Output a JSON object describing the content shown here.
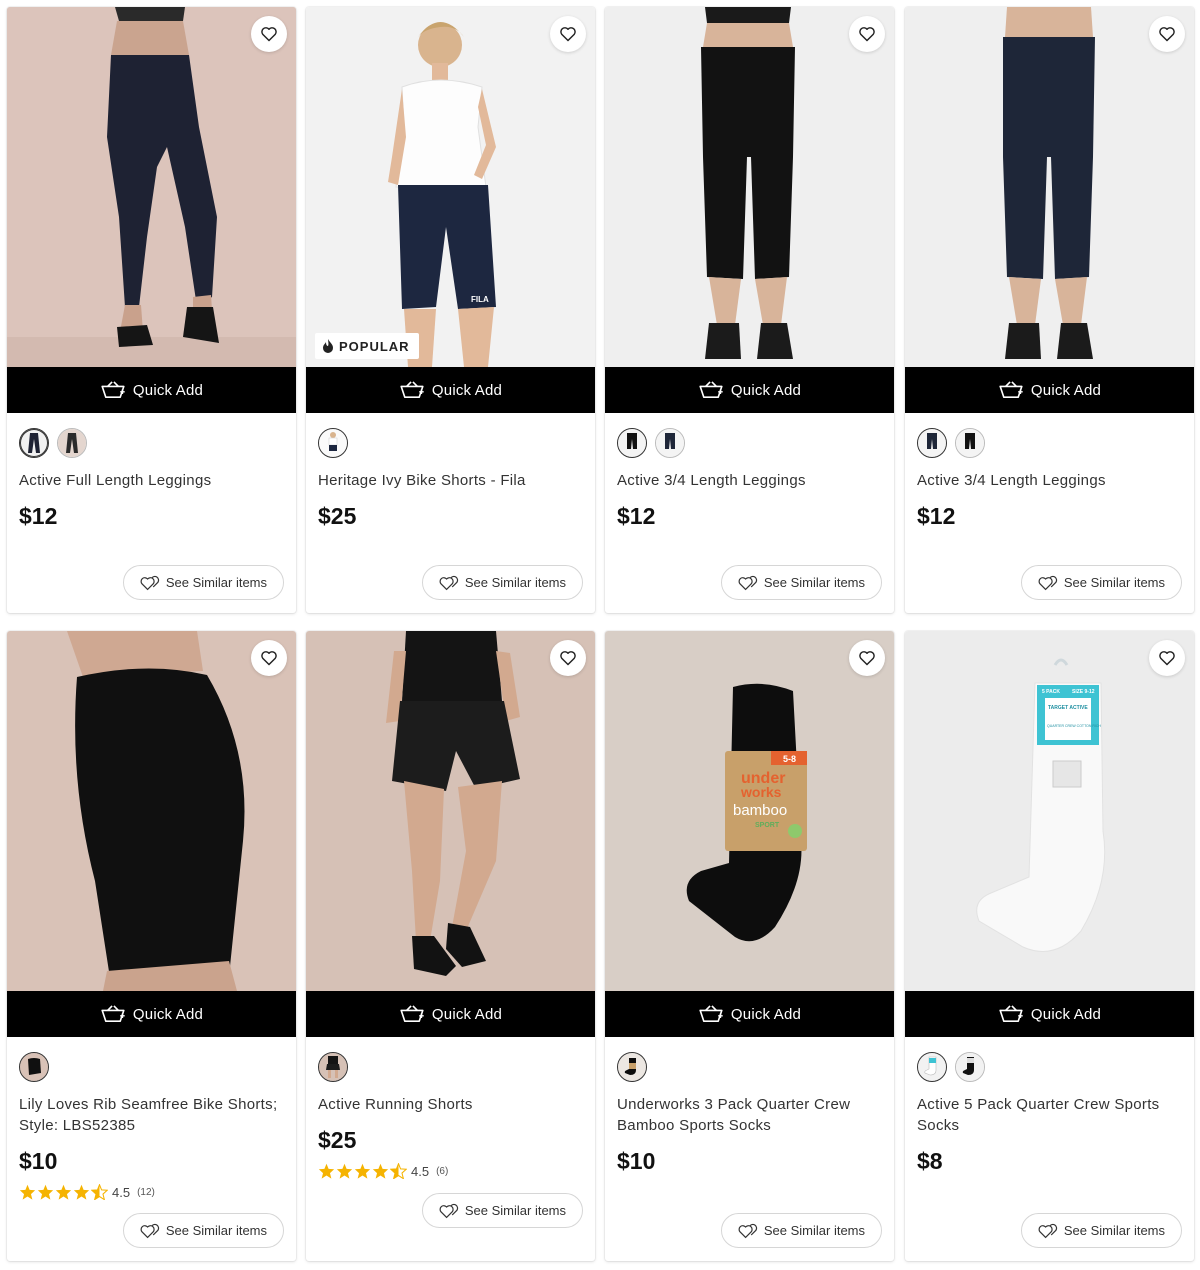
{
  "common": {
    "quick_add_label": "Quick Add",
    "see_similar_label": "See Similar items",
    "accent_color": "#000000",
    "star_color": "#F5B301"
  },
  "products": [
    {
      "name": "Active Full Length Leggings",
      "price": "$12",
      "badge": "",
      "rating": "",
      "rating_count": "",
      "swatches": [
        "navy-leggings",
        "black-leggings"
      ]
    },
    {
      "name": "Heritage Ivy Bike Shorts - Fila",
      "price": "$25",
      "badge": "POPULAR",
      "rating": "",
      "rating_count": "",
      "swatches": [
        "navy-shorts"
      ]
    },
    {
      "name": "Active 3/4 Length Leggings",
      "price": "$12",
      "badge": "",
      "rating": "",
      "rating_count": "",
      "swatches": [
        "black-capri",
        "navy-capri"
      ]
    },
    {
      "name": "Active 3/4 Length Leggings",
      "price": "$12",
      "badge": "",
      "rating": "",
      "rating_count": "",
      "swatches": [
        "navy-capri",
        "black-capri"
      ]
    },
    {
      "name": "Lily Loves Rib Seamfree Bike Shorts; Style: LBS52385",
      "price": "$10",
      "badge": "",
      "rating": "4.5",
      "rating_count": "(12)",
      "swatches": [
        "black-shorts"
      ]
    },
    {
      "name": "Active Running Shorts",
      "price": "$25",
      "badge": "",
      "rating": "4.5",
      "rating_count": "(6)",
      "swatches": [
        "black-shorts"
      ]
    },
    {
      "name": "Underworks 3 Pack Quarter Crew Bamboo Sports Socks",
      "price": "$10",
      "badge": "",
      "rating": "",
      "rating_count": "",
      "swatches": [
        "black-socks"
      ]
    },
    {
      "name": "Active 5 Pack Quarter Crew Sports Socks",
      "price": "$8",
      "badge": "",
      "rating": "",
      "rating_count": "",
      "swatches": [
        "white-socks",
        "black-socks"
      ]
    }
  ],
  "packaging_text": {
    "underworks_brand_top": "under",
    "underworks_brand_bottom": "works",
    "underworks_line": "bamboo",
    "underworks_sub": "SPORT",
    "underworks_size": "5-8",
    "target_pack": "5 PACK",
    "target_size": "SIZE 9-12",
    "target_brand": "TARGET ACTIVE",
    "target_style": "QUARTER CREW COTTON RICH"
  }
}
